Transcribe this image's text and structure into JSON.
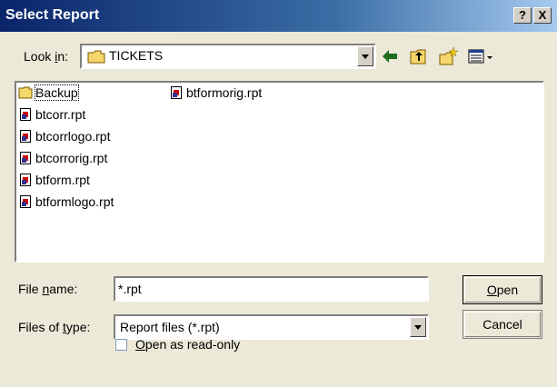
{
  "window": {
    "title": "Select Report",
    "help_label": "?",
    "close_label": "X"
  },
  "look_in": {
    "label_prefix": "Look ",
    "label_accel": "i",
    "label_suffix": "n:",
    "value": "TICKETS"
  },
  "toolbar": {
    "back_icon": "back-arrow-icon",
    "up_icon": "up-folder-icon",
    "new_folder_icon": "new-folder-icon",
    "view_icon": "view-menu-icon"
  },
  "files": [
    {
      "name": "Backup",
      "icon": "folder-icon",
      "selected": true
    },
    {
      "name": "btcorr.rpt",
      "icon": "report-file-icon"
    },
    {
      "name": "btcorrlogo.rpt",
      "icon": "report-file-icon"
    },
    {
      "name": "btcorrorig.rpt",
      "icon": "report-file-icon"
    },
    {
      "name": "btform.rpt",
      "icon": "report-file-icon"
    },
    {
      "name": "btformlogo.rpt",
      "icon": "report-file-icon"
    },
    {
      "name": "btformorig.rpt",
      "icon": "report-file-icon"
    }
  ],
  "file_name": {
    "label_prefix": "File ",
    "label_accel": "n",
    "label_suffix": "ame:",
    "value": "*.rpt"
  },
  "file_type": {
    "label_prefix": "Files of ",
    "label_accel": "t",
    "label_suffix": "ype:",
    "value": "Report files (*.rpt)"
  },
  "buttons": {
    "open_accel": "O",
    "open_rest": "pen",
    "cancel": "Cancel"
  },
  "read_only": {
    "accel": "O",
    "rest": "pen as read-only",
    "checked": false
  },
  "colors": {
    "title_bar": "#0a246a",
    "dialog_bg": "#ece9d8",
    "folder_yellow": "#f5d66b",
    "selection_border": "#000000"
  }
}
